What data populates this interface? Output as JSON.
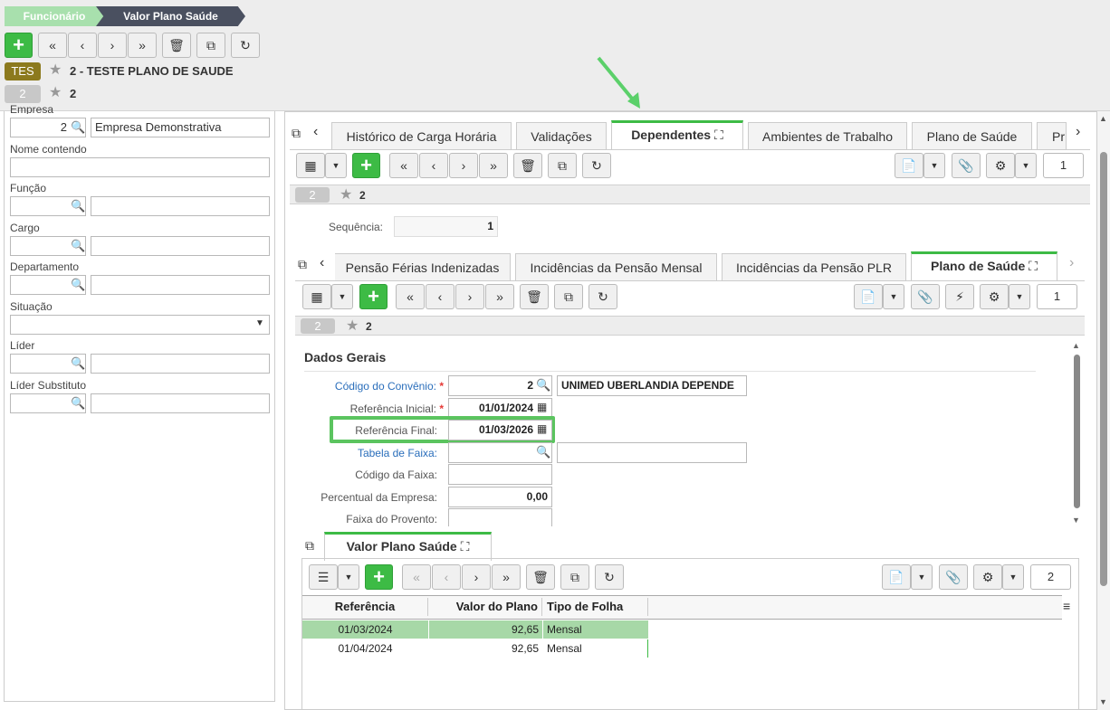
{
  "breadcrumb": {
    "item1": "Funcionário",
    "item2": "Valor Plano Saúde"
  },
  "header": {
    "badge1": "TES",
    "title1": "2 - TESTE PLANO DE SAUDE",
    "badge2": "2",
    "title2": "2"
  },
  "filters": {
    "empresa_label": "Empresa",
    "empresa_code": "2",
    "empresa_name": "Empresa Demonstrativa",
    "nome_label": "Nome contendo",
    "funcao_label": "Função",
    "cargo_label": "Cargo",
    "departamento_label": "Departamento",
    "situacao_label": "Situação",
    "lider_label": "Líder",
    "lider_sub_label": "Líder Substituto"
  },
  "outer_tabs": {
    "t1": "Histórico de Carga Horária",
    "t2": "Validações",
    "t3": "Dependentes",
    "t4": "Ambientes de Trabalho",
    "t5": "Plano de Saúde",
    "t6": "Pr"
  },
  "outer_record": {
    "page": "1",
    "badge": "2",
    "title": "2",
    "sequencia_label": "Sequência:",
    "sequencia_value": "1"
  },
  "inner_tabs": {
    "t1": "Pensão Férias Indenizadas",
    "t2": "Incidências da Pensão Mensal",
    "t3": "Incidências da Pensão PLR",
    "t4": "Plano de Saúde"
  },
  "inner_record": {
    "page": "1",
    "badge": "2",
    "title": "2"
  },
  "form": {
    "section": "Dados Gerais",
    "codigo_label": "Código do Convênio:",
    "codigo_value": "2",
    "codigo_desc": "UNIMED UBERLANDIA DEPENDE",
    "ref_ini_label": "Referência Inicial:",
    "ref_ini_value": "01/01/2024",
    "ref_fin_label": "Referência Final:",
    "ref_fin_value": "01/03/2026",
    "tabela_label": "Tabela de Faixa:",
    "cod_faixa_label": "Código da Faixa:",
    "perc_label": "Percentual da Empresa:",
    "perc_value": "0,00",
    "faixa_prov_label": "Faixa do Provento:"
  },
  "valor_tab": {
    "label": "Valor Plano Saúde",
    "page": "2"
  },
  "grid": {
    "headers": [
      "Referência",
      "Valor do Plano",
      "Tipo de Folha"
    ],
    "rows": [
      [
        "01/03/2024",
        "92,65",
        "Mensal"
      ],
      [
        "01/04/2024",
        "92,65",
        "Mensal"
      ]
    ]
  },
  "colors": {
    "accent": "#3dbb45",
    "crumb1": "#a8e0ad",
    "crumb2": "#4a5060",
    "badge_tes": "#8c7a1e",
    "link": "#2a6ebb",
    "highlight_row": "#a7d8a7"
  }
}
